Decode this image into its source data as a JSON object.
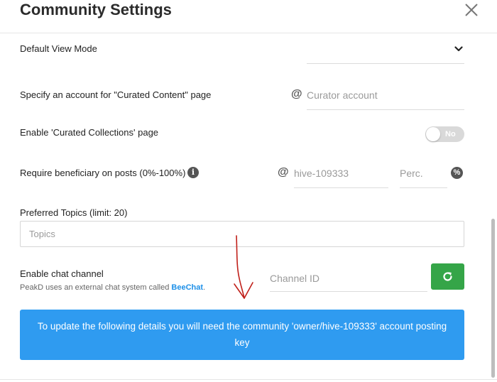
{
  "header": {
    "title": "Community Settings"
  },
  "default_view": {
    "label": "Default View Mode"
  },
  "curated_content": {
    "label": "Specify an account for \"Curated Content\" page",
    "placeholder": "Curator account"
  },
  "curated_collections": {
    "label": "Enable 'Curated Collections' page",
    "toggle_text": "No",
    "enabled": false
  },
  "beneficiary": {
    "label": "Require beneficiary on posts (0%-100%)",
    "account_value": "hive-109333",
    "perc_placeholder": "Perc.",
    "info_glyph": "i",
    "percent_glyph": "%"
  },
  "topics": {
    "label": "Preferred Topics (limit: 20)",
    "placeholder": "Topics"
  },
  "chat": {
    "label": "Enable chat channel",
    "note": "PeakD uses an external chat system called ",
    "link": "BeeChat",
    "note_end": ".",
    "channel_placeholder": "Channel ID"
  },
  "banner": {
    "text": "To update the following details you will need the community 'owner/hive-109333' account posting key"
  },
  "glyphs": {
    "at": "@"
  },
  "colors": {
    "banner": "#2f9bf0",
    "refresh": "#35a548",
    "link": "#1e90e8",
    "annotation": "#c0201a"
  }
}
